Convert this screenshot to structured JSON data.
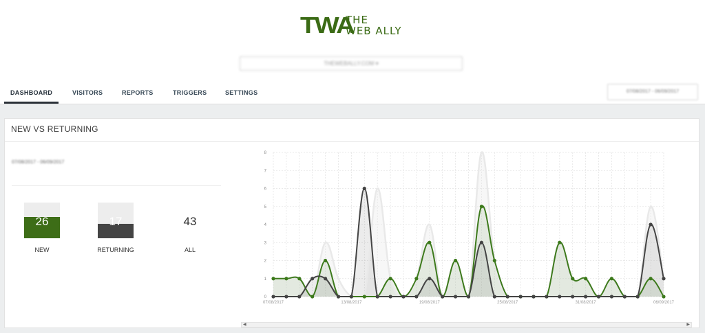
{
  "logo": {
    "mark": "TWA",
    "line1": "THE",
    "line2": "WEB ALLY"
  },
  "site_select": {
    "value": "THEWEBALLY.COM ▾"
  },
  "tabs": [
    {
      "label": "DASHBOARD",
      "active": true
    },
    {
      "label": "VISITORS",
      "active": false
    },
    {
      "label": "REPORTS",
      "active": false
    },
    {
      "label": "TRIGGERS",
      "active": false
    },
    {
      "label": "SETTINGS",
      "active": false
    }
  ],
  "header_date_range": "07/08/2017 - 06/09/2017",
  "panel": {
    "title": "NEW VS RETURNING",
    "date_range": "07/08/2017 - 06/09/2017"
  },
  "stats": {
    "new": {
      "value": "26",
      "label": "NEW",
      "fraction": 0.6,
      "color": "#3d6d17"
    },
    "returning": {
      "value": "17",
      "label": "RETURNING",
      "fraction": 0.4,
      "color": "#444444"
    },
    "all": {
      "value": "43",
      "label": "ALL"
    }
  },
  "colors": {
    "accent": "#3b6b15",
    "new_series": "#3d7a1c",
    "returning_series": "#444444",
    "all_series": "#e9e9e9"
  },
  "chart_data": {
    "type": "line",
    "x": [
      "07/08/2017",
      "08/08/2017",
      "09/08/2017",
      "10/08/2017",
      "11/08/2017",
      "12/08/2017",
      "13/08/2017",
      "14/08/2017",
      "15/08/2017",
      "16/08/2017",
      "17/08/2017",
      "18/08/2017",
      "19/08/2017",
      "20/08/2017",
      "21/08/2017",
      "22/08/2017",
      "23/08/2017",
      "24/08/2017",
      "25/08/2017",
      "26/08/2017",
      "27/08/2017",
      "28/08/2017",
      "29/08/2017",
      "30/08/2017",
      "31/08/2017",
      "01/09/2017",
      "02/09/2017",
      "03/09/2017",
      "04/09/2017",
      "05/09/2017",
      "06/09/2017"
    ],
    "x_tick_labels": [
      "07/08/2017",
      "13/08/2017",
      "19/08/2017",
      "25/08/2017",
      "31/08/2017",
      "06/09/2017"
    ],
    "series": [
      {
        "name": "",
        "values": [
          1,
          1,
          1,
          0,
          3,
          1,
          0,
          0,
          6,
          1,
          0,
          1,
          4,
          0,
          2,
          0,
          8,
          2,
          0,
          0,
          0,
          0,
          3,
          1,
          1,
          0,
          1,
          0,
          0,
          5,
          1
        ]
      },
      {
        "name": "",
        "values": [
          1,
          1,
          1,
          0,
          2,
          0,
          0,
          0,
          0,
          1,
          0,
          1,
          3,
          0,
          2,
          0,
          5,
          2,
          0,
          0,
          0,
          0,
          3,
          1,
          1,
          0,
          1,
          0,
          0,
          1,
          0
        ]
      },
      {
        "name": "",
        "values": [
          0,
          0,
          0,
          1,
          1,
          0,
          0,
          6,
          0,
          0,
          0,
          0,
          1,
          0,
          0,
          0,
          3,
          0,
          0,
          0,
          0,
          0,
          0,
          0,
          0,
          0,
          0,
          0,
          0,
          4,
          1
        ]
      }
    ],
    "ylim": [
      0,
      8
    ],
    "y_ticks": [
      "0",
      "1",
      "2",
      "3",
      "4",
      "5",
      "6",
      "7",
      "8"
    ],
    "grid": true
  }
}
